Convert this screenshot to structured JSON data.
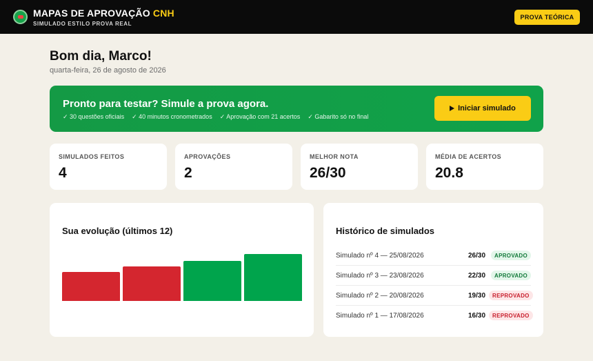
{
  "header": {
    "title_main": "MAPAS DE APROVAÇÃO ",
    "title_accent": "CNH",
    "subtitle": "SIMULADO ESTILO PROVA REAL",
    "button_label": "PROVA TEÓRICA"
  },
  "greeting": "Bom dia, Marco!",
  "date": "quarta-feira, 26 de agosto de 2026",
  "banner": {
    "title": "Pronto para testar? Simule a prova agora.",
    "features": [
      "✓ 30 questões oficiais",
      "✓ 40 minutos cronometrados",
      "✓ Aprovação com 21 acertos",
      "✓ Gabarito só no final"
    ],
    "button_label": "Iniciar simulado"
  },
  "stats": [
    {
      "label": "SIMULADOS FEITOS",
      "value": "4"
    },
    {
      "label": "APROVAÇÕES",
      "value": "2"
    },
    {
      "label": "MELHOR NOTA",
      "value": "26/30"
    },
    {
      "label": "MÉDIA DE ACERTOS",
      "value": "20.8"
    }
  ],
  "evolution": {
    "title": "Sua evolução (últimos 12)",
    "scores": [
      {
        "value": 16,
        "max": 30,
        "status": "fail"
      },
      {
        "value": 19,
        "max": 30,
        "status": "fail"
      },
      {
        "value": 22,
        "max": 30,
        "status": "ok"
      },
      {
        "value": 26,
        "max": 30,
        "status": "ok"
      }
    ]
  },
  "history": {
    "title": "Histórico de simulados",
    "rows": [
      {
        "name": "Simulado nº 4 — 25/08/2026",
        "score": "26/30",
        "status": "APROVADO",
        "ok": true
      },
      {
        "name": "Simulado nº 3 — 23/08/2026",
        "score": "22/30",
        "status": "APROVADO",
        "ok": true
      },
      {
        "name": "Simulado nº 2 — 20/08/2026",
        "score": "19/30",
        "status": "REPROVADO",
        "ok": false
      },
      {
        "name": "Simulado nº 1 — 17/08/2026",
        "score": "16/30",
        "status": "REPROVADO",
        "ok": false
      }
    ]
  },
  "colors": {
    "pass": "#00a44c",
    "fail": "#d4262f",
    "accent": "#facc15",
    "brand_green": "#149a45"
  }
}
